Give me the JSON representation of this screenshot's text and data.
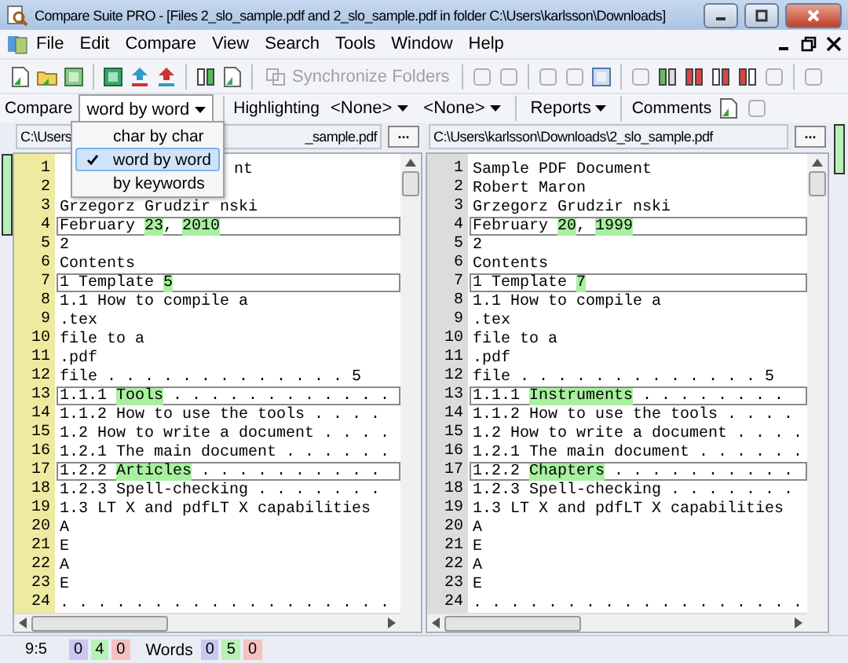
{
  "window": {
    "title": "Compare Suite PRO - [Files 2_slo_sample.pdf and 2_slo_sample.pdf in folder C:\\Users\\karlsson\\Downloads]"
  },
  "menu": [
    "File",
    "Edit",
    "Compare",
    "View",
    "Search",
    "Tools",
    "Window",
    "Help"
  ],
  "toolbar": {
    "sync_button": {
      "label": "Synchronize Folders",
      "disabled": true
    }
  },
  "compare_bar": {
    "compare_label": "Compare",
    "mode": {
      "value": "word by word",
      "expanded": true
    },
    "highlighting_label": "Highlighting",
    "filters": [
      "<None>",
      "<None>"
    ],
    "reports": "Reports",
    "comments": "Comments"
  },
  "mode_menu": [
    {
      "label": "char by char",
      "selected": false
    },
    {
      "label": "word by word",
      "selected": true
    },
    {
      "label": "by keywords",
      "selected": false
    }
  ],
  "panes": [
    {
      "path": "C:\\Users",
      "path_tail": "_sample.pdf",
      "browse_label": "...",
      "gutter_highlighted": true,
      "lines": [
        {
          "num": "1",
          "covered": true,
          "segments": [
            {
              "text": "nt",
              "changed": false
            }
          ]
        },
        {
          "num": "2",
          "covered": true
        },
        {
          "num": "3",
          "framed": false,
          "segments": [
            {
              "text": "Grzegorz Grudzir nski",
              "changed": false
            }
          ]
        },
        {
          "num": "4",
          "framed": true,
          "segments": [
            {
              "text": "February ",
              "changed": false
            },
            {
              "text": "23",
              "changed": true
            },
            {
              "text": ", ",
              "changed": false
            },
            {
              "text": "2010",
              "changed": true
            }
          ]
        },
        {
          "num": "5",
          "framed": false,
          "segments": [
            {
              "text": "2",
              "changed": false
            }
          ]
        },
        {
          "num": "6",
          "framed": false,
          "segments": [
            {
              "text": "Contents",
              "changed": false
            }
          ]
        },
        {
          "num": "7",
          "framed": true,
          "segments": [
            {
              "text": "1 Template ",
              "changed": false
            },
            {
              "text": "5",
              "changed": true
            }
          ]
        },
        {
          "num": "8",
          "framed": false,
          "segments": [
            {
              "text": "1.1 How to compile a",
              "changed": false
            }
          ]
        },
        {
          "num": "9",
          "framed": false,
          "segments": [
            {
              "text": ".tex",
              "changed": false
            }
          ]
        },
        {
          "num": "10",
          "framed": false,
          "segments": [
            {
              "text": "file to a",
              "changed": false
            }
          ]
        },
        {
          "num": "11",
          "framed": false,
          "segments": [
            {
              "text": ".pdf",
              "changed": false
            }
          ]
        },
        {
          "num": "12",
          "framed": false,
          "segments": [
            {
              "text": "file . . . . . . . . . . . . . 5",
              "changed": false
            }
          ]
        },
        {
          "num": "13",
          "framed": true,
          "segments": [
            {
              "text": "1.1.1 ",
              "changed": false
            },
            {
              "text": "Tools",
              "changed": true
            },
            {
              "text": " . . . . . . . . . . . .",
              "changed": false
            }
          ]
        },
        {
          "num": "14",
          "framed": false,
          "segments": [
            {
              "text": "1.1.2 How to use the tools . . . .",
              "changed": false
            }
          ]
        },
        {
          "num": "15",
          "framed": false,
          "segments": [
            {
              "text": "1.2 How to write a document . . . .",
              "changed": false
            }
          ]
        },
        {
          "num": "16",
          "framed": false,
          "segments": [
            {
              "text": "1.2.1 The main document . . . . . .",
              "changed": false
            }
          ]
        },
        {
          "num": "17",
          "framed": true,
          "segments": [
            {
              "text": "1.2.2 ",
              "changed": false
            },
            {
              "text": "Articles",
              "changed": true
            },
            {
              "text": " . . . . . . . . . .",
              "changed": false
            }
          ]
        },
        {
          "num": "18",
          "framed": false,
          "segments": [
            {
              "text": "1.2.3 Spell-checking . . . . . . .",
              "changed": false
            }
          ]
        },
        {
          "num": "19",
          "framed": false,
          "segments": [
            {
              "text": "1.3 LT X and pdfLT X capabilities",
              "changed": false
            }
          ]
        },
        {
          "num": "20",
          "framed": false,
          "segments": [
            {
              "text": "A",
              "changed": false
            }
          ]
        },
        {
          "num": "21",
          "framed": false,
          "segments": [
            {
              "text": "E",
              "changed": false
            }
          ]
        },
        {
          "num": "22",
          "framed": false,
          "segments": [
            {
              "text": "A",
              "changed": false
            }
          ]
        },
        {
          "num": "23",
          "framed": false,
          "segments": [
            {
              "text": "E",
              "changed": false
            }
          ]
        },
        {
          "num": "24",
          "framed": false,
          "segments": [
            {
              "text": ". . . . . . . . . . . . . . . . . .",
              "changed": false
            }
          ]
        }
      ]
    },
    {
      "path": "C:\\Users\\karlsson\\Downloads\\2_slo_sample.pdf",
      "browse_label": "...",
      "gutter_highlighted": false,
      "lines": [
        {
          "num": "1",
          "framed": false,
          "segments": [
            {
              "text": "Sample PDF Document",
              "changed": false
            }
          ]
        },
        {
          "num": "2",
          "framed": false,
          "segments": [
            {
              "text": "Robert Maron",
              "changed": false
            }
          ]
        },
        {
          "num": "3",
          "framed": false,
          "segments": [
            {
              "text": "Grzegorz Grudzir nski",
              "changed": false
            }
          ]
        },
        {
          "num": "4",
          "framed": true,
          "segments": [
            {
              "text": "February ",
              "changed": false
            },
            {
              "text": "20",
              "changed": true
            },
            {
              "text": ", ",
              "changed": false
            },
            {
              "text": "1999",
              "changed": true
            }
          ]
        },
        {
          "num": "5",
          "framed": false,
          "segments": [
            {
              "text": "2",
              "changed": false
            }
          ]
        },
        {
          "num": "6",
          "framed": false,
          "segments": [
            {
              "text": "Contents",
              "changed": false
            }
          ]
        },
        {
          "num": "7",
          "framed": true,
          "segments": [
            {
              "text": "1 Template ",
              "changed": false
            },
            {
              "text": "7",
              "changed": true
            }
          ]
        },
        {
          "num": "8",
          "framed": false,
          "segments": [
            {
              "text": "1.1 How to compile a",
              "changed": false
            }
          ]
        },
        {
          "num": "9",
          "framed": false,
          "segments": [
            {
              "text": ".tex",
              "changed": false
            }
          ]
        },
        {
          "num": "10",
          "framed": false,
          "segments": [
            {
              "text": "file to a",
              "changed": false
            }
          ]
        },
        {
          "num": "11",
          "framed": false,
          "segments": [
            {
              "text": ".pdf",
              "changed": false
            }
          ]
        },
        {
          "num": "12",
          "framed": false,
          "segments": [
            {
              "text": "file . . . . . . . . . . . . . 5",
              "changed": false
            }
          ]
        },
        {
          "num": "13",
          "framed": true,
          "segments": [
            {
              "text": "1.1.1 ",
              "changed": false
            },
            {
              "text": "Instruments",
              "changed": true
            },
            {
              "text": " . . . . . . . .",
              "changed": false
            }
          ]
        },
        {
          "num": "14",
          "framed": false,
          "segments": [
            {
              "text": "1.1.2 How to use the tools . . . .",
              "changed": false
            }
          ]
        },
        {
          "num": "15",
          "framed": false,
          "segments": [
            {
              "text": "1.2 How to write a document . . . .",
              "changed": false
            }
          ]
        },
        {
          "num": "16",
          "framed": false,
          "segments": [
            {
              "text": "1.2.1 The main document . . . . . .",
              "changed": false
            }
          ]
        },
        {
          "num": "17",
          "framed": true,
          "segments": [
            {
              "text": "1.2.2 ",
              "changed": false
            },
            {
              "text": "Chapters",
              "changed": true
            },
            {
              "text": " . . . . . . . . . .",
              "changed": false
            }
          ]
        },
        {
          "num": "18",
          "framed": false,
          "segments": [
            {
              "text": "1.2.3 Spell-checking . . . . . . .",
              "changed": false
            }
          ]
        },
        {
          "num": "19",
          "framed": false,
          "segments": [
            {
              "text": "1.3 LT X and pdfLT X capabilities",
              "changed": false
            }
          ]
        },
        {
          "num": "20",
          "framed": false,
          "segments": [
            {
              "text": "A",
              "changed": false
            }
          ]
        },
        {
          "num": "21",
          "framed": false,
          "segments": [
            {
              "text": "E",
              "changed": false
            }
          ]
        },
        {
          "num": "22",
          "framed": false,
          "segments": [
            {
              "text": "A",
              "changed": false
            }
          ]
        },
        {
          "num": "23",
          "framed": false,
          "segments": [
            {
              "text": "E",
              "changed": false
            }
          ]
        },
        {
          "num": "24",
          "framed": false,
          "segments": [
            {
              "text": ". . . . . . . . . . . . . . . . . .",
              "changed": false
            }
          ]
        }
      ]
    }
  ],
  "status_bar": {
    "position": "9:5",
    "line_counts": [
      {
        "value": "0",
        "color": "#c8c8f0"
      },
      {
        "value": "4",
        "color": "#b8f0b8"
      },
      {
        "value": "0",
        "color": "#f4c0c0"
      }
    ],
    "words_label": "Words",
    "word_counts": [
      {
        "value": "0",
        "color": "#c8c8f0"
      },
      {
        "value": "5",
        "color": "#b8f0b8"
      },
      {
        "value": "0",
        "color": "#f4c0c0"
      }
    ]
  }
}
